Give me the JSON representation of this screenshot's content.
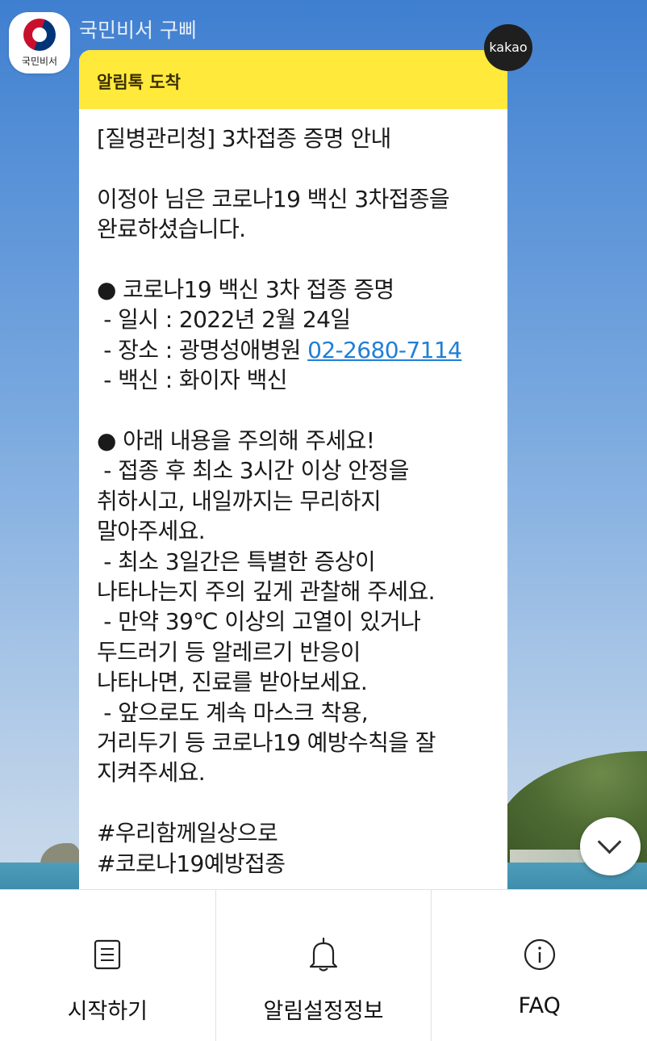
{
  "sender_name": "국민비서 구삐",
  "profile": {
    "label": "국민비서"
  },
  "kakao_badge": "kakao",
  "card": {
    "header": "알림톡 도착",
    "lines": [
      "[질병관리청] 3차접종 증명 안내",
      "",
      "이정아 님은 코로나19 백신 3차접종을",
      "완료하셨습니다.",
      "",
      "● 코로나19 백신 3차 접종 증명",
      " - 일시 : 2022년 2월 24일",
      "PHONE",
      " - 백신 : 화이자 백신",
      "",
      "● 아래 내용을 주의해 주세요!",
      " - 접종 후 최소 3시간 이상 안정을",
      "취하시고, 내일까지는 무리하지",
      "말아주세요.",
      " - 최소 3일간은 특별한 증상이",
      "나타나는지 주의 깊게 관찰해 주세요.",
      " - 만약 39℃ 이상의 고열이 있거나",
      "두드러기 등 알레르기 반응이",
      "나타나면, 진료를 받아보세요.",
      " - 앞으로도 계속 마스크 착용,",
      "거리두기 등 코로나19 예방수칙을 잘",
      "지켜주세요.",
      "",
      "#우리함께일상으로",
      "#코로나19예방접종"
    ],
    "place_prefix": " - 장소 : 광명성애병원 ",
    "phone": "02-2680-7114"
  },
  "tabs": [
    {
      "label": "시작하기",
      "icon": "document-icon"
    },
    {
      "label": "알림설정정보",
      "icon": "bell-icon"
    },
    {
      "label": "FAQ",
      "icon": "info-icon"
    }
  ],
  "colors": {
    "header_yellow": "#ffe93b",
    "link_blue": "#1f7fd6"
  }
}
